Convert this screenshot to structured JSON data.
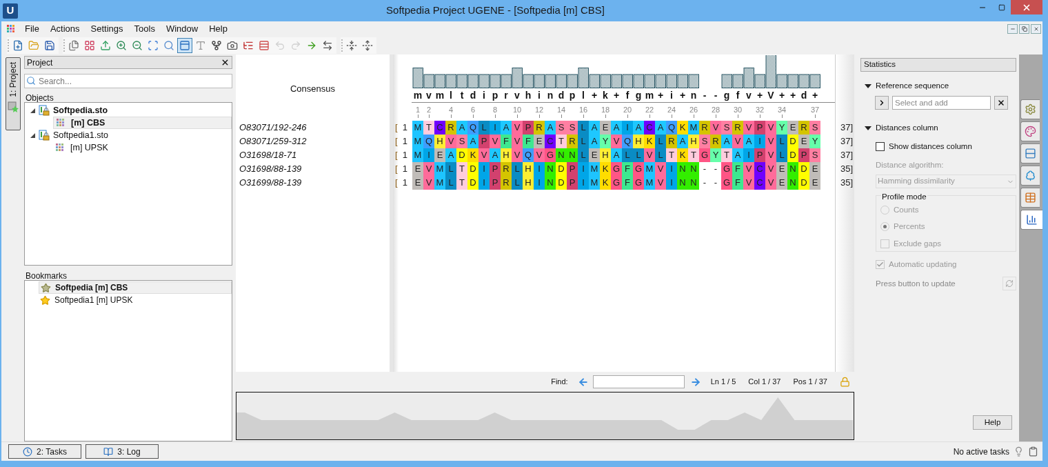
{
  "window": {
    "logo": "U",
    "title": "Softpedia Project UGENE - [Softpedia [m] CBS]"
  },
  "menu": [
    "File",
    "Actions",
    "Settings",
    "Tools",
    "Window",
    "Help"
  ],
  "toolbar": [
    [
      {
        "kind": "new",
        "selected": false,
        "disabled": false
      },
      {
        "kind": "open",
        "selected": false,
        "disabled": false
      },
      {
        "kind": "save",
        "selected": false,
        "disabled": false
      }
    ],
    [
      {
        "kind": "copy",
        "selected": false,
        "disabled": false
      },
      {
        "kind": "export",
        "selected": false,
        "disabled": false
      },
      {
        "kind": "import",
        "selected": false,
        "disabled": false
      },
      {
        "kind": "zoom-in",
        "selected": false,
        "disabled": false
      },
      {
        "kind": "zoom-out",
        "selected": false,
        "disabled": false
      },
      {
        "kind": "zoom-fit",
        "selected": false,
        "disabled": false
      },
      {
        "kind": "zoom-reset",
        "selected": false,
        "disabled": false
      },
      {
        "kind": "overview",
        "selected": true,
        "disabled": false
      },
      {
        "kind": "add-text",
        "selected": false,
        "disabled": false
      },
      {
        "kind": "tree",
        "selected": false,
        "disabled": false
      },
      {
        "kind": "camera",
        "selected": false,
        "disabled": false
      },
      {
        "kind": "list",
        "selected": false,
        "disabled": false
      },
      {
        "kind": "rows",
        "selected": false,
        "disabled": false
      },
      {
        "kind": "undo",
        "selected": false,
        "disabled": true
      },
      {
        "kind": "redo",
        "selected": false,
        "disabled": true
      },
      {
        "kind": "next",
        "selected": false,
        "disabled": false
      },
      {
        "kind": "swap",
        "selected": false,
        "disabled": false
      }
    ],
    [
      {
        "kind": "collapse",
        "selected": false,
        "disabled": false
      },
      {
        "kind": "expand",
        "selected": false,
        "disabled": false
      }
    ]
  ],
  "side_tabs": [
    {
      "label": "1: Project",
      "selected": true
    }
  ],
  "project": {
    "title": "Project",
    "search": {
      "placeholder": "Search..."
    },
    "objects_label": "Objects",
    "tree": [
      {
        "label": "Softpedia.sto",
        "active": true,
        "expanded": true,
        "children": [
          {
            "label": "[m] CBS",
            "active": true,
            "selected": true
          }
        ]
      },
      {
        "label": "Softpedia1.sto",
        "active": false,
        "expanded": true,
        "children": [
          {
            "label": "[m] UPSK",
            "active": false,
            "selected": false
          }
        ]
      }
    ],
    "bookmarks_label": "Bookmarks",
    "bookmarks": [
      {
        "label": "Softpedia [m] CBS",
        "active": true,
        "selected": true
      },
      {
        "label": "Softpedia1 [m] UPSK",
        "active": false,
        "selected": false
      }
    ]
  },
  "alignment": {
    "consensus_label": "Consensus",
    "consensus": [
      "m",
      "v",
      "m",
      "l",
      "t",
      "d",
      "i",
      "p",
      "r",
      "v",
      "h",
      "i",
      "n",
      "d",
      "p",
      "l",
      "+",
      "k",
      "+",
      "f",
      "g",
      "m",
      "+",
      "i",
      "+",
      "n",
      "-",
      "-",
      "g",
      "f",
      "v",
      "+",
      "V",
      "+",
      "+",
      "d",
      "+"
    ],
    "ruler": [
      "1",
      "2",
      "4",
      "6",
      "8",
      "10",
      "12",
      "14",
      "16",
      "18",
      "20",
      "22",
      "24",
      "26",
      "28",
      "30",
      "32",
      "34",
      "37"
    ],
    "rows": [
      {
        "name": "O83071/192-246",
        "bracket": "[",
        "start": "1",
        "end": "37]",
        "residues": [
          {
            "residue": "M",
            "color": "#1ec4ff"
          },
          {
            "residue": "T",
            "color": "#ffccdd"
          },
          {
            "residue": "C",
            "color": "#7000ff"
          },
          {
            "residue": "R",
            "color": "#d4c400"
          },
          {
            "residue": "A",
            "color": "#1ec8ff"
          },
          {
            "residue": "Q",
            "color": "#3d9eff"
          },
          {
            "residue": "L",
            "color": "#0a8cc4"
          },
          {
            "residue": "I",
            "color": "#00a6e8"
          },
          {
            "residue": "A",
            "color": "#1ec8ff"
          },
          {
            "residue": "V",
            "color": "#ff6b9a"
          },
          {
            "residue": "P",
            "color": "#d2416e"
          },
          {
            "residue": "R",
            "color": "#d4c400"
          },
          {
            "residue": "A",
            "color": "#1ec8ff"
          },
          {
            "residue": "S",
            "color": "#ff7fa2"
          },
          {
            "residue": "S",
            "color": "#ff7fa2"
          },
          {
            "residue": "L",
            "color": "#0a8cc4"
          },
          {
            "residue": "A",
            "color": "#1ec8ff"
          },
          {
            "residue": "E",
            "color": "#c0bcb8"
          },
          {
            "residue": "A",
            "color": "#1ec8ff"
          },
          {
            "residue": "I",
            "color": "#00a6e8"
          },
          {
            "residue": "A",
            "color": "#1ec8ff"
          },
          {
            "residue": "C",
            "color": "#7000ff"
          },
          {
            "residue": "A",
            "color": "#1ec8ff"
          },
          {
            "residue": "Q",
            "color": "#3d9eff"
          },
          {
            "residue": "K",
            "color": "#ffdd00"
          },
          {
            "residue": "M",
            "color": "#1ec4ff"
          },
          {
            "residue": "R",
            "color": "#d4c400"
          },
          {
            "residue": "V",
            "color": "#ff6b9a"
          },
          {
            "residue": "S",
            "color": "#ff7fa2"
          },
          {
            "residue": "R",
            "color": "#d4c400"
          },
          {
            "residue": "V",
            "color": "#ff6b9a"
          },
          {
            "residue": "P",
            "color": "#d2416e"
          },
          {
            "residue": "V",
            "color": "#ff6b9a"
          },
          {
            "residue": "Y",
            "color": "#66ffaa"
          },
          {
            "residue": "E",
            "color": "#c0bcb8"
          },
          {
            "residue": "R",
            "color": "#d4c400"
          },
          {
            "residue": "S",
            "color": "#ff7fa2"
          }
        ]
      },
      {
        "name": "O83071/259-312",
        "bracket": "[",
        "start": "1",
        "end": "37]",
        "residues": [
          {
            "residue": "M",
            "color": "#1ec4ff"
          },
          {
            "residue": "Q",
            "color": "#3d9eff"
          },
          {
            "residue": "H",
            "color": "#ffee33"
          },
          {
            "residue": "V",
            "color": "#ff6b9a"
          },
          {
            "residue": "S",
            "color": "#ff7fa2"
          },
          {
            "residue": "A",
            "color": "#1ec8ff"
          },
          {
            "residue": "P",
            "color": "#d2416e"
          },
          {
            "residue": "V",
            "color": "#ff6b9a"
          },
          {
            "residue": "F",
            "color": "#3ee890"
          },
          {
            "residue": "V",
            "color": "#ff6b9a"
          },
          {
            "residue": "F",
            "color": "#3ee890"
          },
          {
            "residue": "E",
            "color": "#c0bcb8"
          },
          {
            "residue": "C",
            "color": "#7000ff"
          },
          {
            "residue": "T",
            "color": "#ffccdd"
          },
          {
            "residue": "R",
            "color": "#d4c400"
          },
          {
            "residue": "L",
            "color": "#0a8cc4"
          },
          {
            "residue": "A",
            "color": "#1ec8ff"
          },
          {
            "residue": "Y",
            "color": "#66ffaa"
          },
          {
            "residue": "V",
            "color": "#ff6b9a"
          },
          {
            "residue": "Q",
            "color": "#3d9eff"
          },
          {
            "residue": "H",
            "color": "#ffee33"
          },
          {
            "residue": "K",
            "color": "#ffdd00"
          },
          {
            "residue": "L",
            "color": "#0a8cc4"
          },
          {
            "residue": "R",
            "color": "#d4c400"
          },
          {
            "residue": "A",
            "color": "#1ec8ff"
          },
          {
            "residue": "H",
            "color": "#ffee33"
          },
          {
            "residue": "S",
            "color": "#ff7fa2"
          },
          {
            "residue": "R",
            "color": "#d4c400"
          },
          {
            "residue": "A",
            "color": "#1ec8ff"
          },
          {
            "residue": "V",
            "color": "#ff6b9a"
          },
          {
            "residue": "A",
            "color": "#1ec8ff"
          },
          {
            "residue": "I",
            "color": "#00a6e8"
          },
          {
            "residue": "V",
            "color": "#ff6b9a"
          },
          {
            "residue": "L",
            "color": "#0a8cc4"
          },
          {
            "residue": "D",
            "color": "#ffff00"
          },
          {
            "residue": "E",
            "color": "#c0bcb8"
          },
          {
            "residue": "Y",
            "color": "#66ffaa"
          }
        ]
      },
      {
        "name": "O31698/18-71",
        "bracket": "[",
        "start": "1",
        "end": "37]",
        "residues": [
          {
            "residue": "M",
            "color": "#1ec4ff"
          },
          {
            "residue": "I",
            "color": "#00a6e8"
          },
          {
            "residue": "E",
            "color": "#c0bcb8"
          },
          {
            "residue": "A",
            "color": "#1ec8ff"
          },
          {
            "residue": "D",
            "color": "#ffff00"
          },
          {
            "residue": "K",
            "color": "#ffdd00"
          },
          {
            "residue": "V",
            "color": "#ff6b9a"
          },
          {
            "residue": "A",
            "color": "#1ec8ff"
          },
          {
            "residue": "H",
            "color": "#ffee33"
          },
          {
            "residue": "V",
            "color": "#ff6b9a"
          },
          {
            "residue": "Q",
            "color": "#3d9eff"
          },
          {
            "residue": "V",
            "color": "#ff6b9a"
          },
          {
            "residue": "G",
            "color": "#ff5585"
          },
          {
            "residue": "N",
            "color": "#33ee00"
          },
          {
            "residue": "N",
            "color": "#33ee00"
          },
          {
            "residue": "L",
            "color": "#0a8cc4"
          },
          {
            "residue": "E",
            "color": "#c0bcb8"
          },
          {
            "residue": "H",
            "color": "#ffee33"
          },
          {
            "residue": "A",
            "color": "#1ec8ff"
          },
          {
            "residue": "L",
            "color": "#0a8cc4"
          },
          {
            "residue": "L",
            "color": "#0a8cc4"
          },
          {
            "residue": "V",
            "color": "#ff6b9a"
          },
          {
            "residue": "L",
            "color": "#0a8cc4"
          },
          {
            "residue": "T",
            "color": "#ffccdd"
          },
          {
            "residue": "K",
            "color": "#ffdd00"
          },
          {
            "residue": "T",
            "color": "#ffccdd"
          },
          {
            "residue": "G",
            "color": "#ff5585"
          },
          {
            "residue": "Y",
            "color": "#66ffaa"
          },
          {
            "residue": "T",
            "color": "#ffccdd"
          },
          {
            "residue": "A",
            "color": "#1ec8ff"
          },
          {
            "residue": "I",
            "color": "#00a6e8"
          },
          {
            "residue": "P",
            "color": "#d2416e"
          },
          {
            "residue": "V",
            "color": "#ff6b9a"
          },
          {
            "residue": "L",
            "color": "#0a8cc4"
          },
          {
            "residue": "D",
            "color": "#ffff00"
          },
          {
            "residue": "P",
            "color": "#d2416e"
          },
          {
            "residue": "S",
            "color": "#ff7fa2"
          }
        ]
      },
      {
        "name": "O31698/88-139",
        "bracket": "[",
        "start": "1",
        "end": "35]",
        "residues": [
          {
            "residue": "E",
            "color": "#c0bcb8"
          },
          {
            "residue": "V",
            "color": "#ff6b9a"
          },
          {
            "residue": "M",
            "color": "#1ec4ff"
          },
          {
            "residue": "L",
            "color": "#0a8cc4"
          },
          {
            "residue": "T",
            "color": "#ffccdd"
          },
          {
            "residue": "D",
            "color": "#ffff00"
          },
          {
            "residue": "I",
            "color": "#00a6e8"
          },
          {
            "residue": "P",
            "color": "#d2416e"
          },
          {
            "residue": "R",
            "color": "#d4c400"
          },
          {
            "residue": "L",
            "color": "#0a8cc4"
          },
          {
            "residue": "H",
            "color": "#ffee33"
          },
          {
            "residue": "I",
            "color": "#00a6e8"
          },
          {
            "residue": "N",
            "color": "#33ee00"
          },
          {
            "residue": "D",
            "color": "#ffff00"
          },
          {
            "residue": "P",
            "color": "#d2416e"
          },
          {
            "residue": "I",
            "color": "#00a6e8"
          },
          {
            "residue": "M",
            "color": "#1ec4ff"
          },
          {
            "residue": "K",
            "color": "#ffdd00"
          },
          {
            "residue": "G",
            "color": "#ff5585"
          },
          {
            "residue": "F",
            "color": "#3ee890"
          },
          {
            "residue": "G",
            "color": "#ff5585"
          },
          {
            "residue": "M",
            "color": "#1ec4ff"
          },
          {
            "residue": "V",
            "color": "#ff6b9a"
          },
          {
            "residue": "I",
            "color": "#00a6e8"
          },
          {
            "residue": "N",
            "color": "#33ee00"
          },
          {
            "residue": "N",
            "color": "#33ee00"
          },
          {
            "residue": "-",
            "color": "#ffffff"
          },
          {
            "residue": "-",
            "color": "#ffffff"
          },
          {
            "residue": "G",
            "color": "#ff5585"
          },
          {
            "residue": "F",
            "color": "#3ee890"
          },
          {
            "residue": "V",
            "color": "#ff6b9a"
          },
          {
            "residue": "C",
            "color": "#7000ff"
          },
          {
            "residue": "V",
            "color": "#ff6b9a"
          },
          {
            "residue": "E",
            "color": "#c0bcb8"
          },
          {
            "residue": "N",
            "color": "#33ee00"
          },
          {
            "residue": "D",
            "color": "#ffff00"
          },
          {
            "residue": "E",
            "color": "#c0bcb8"
          }
        ]
      },
      {
        "name": "O31699/88-139",
        "bracket": "[",
        "start": "1",
        "end": "35]",
        "residues": [
          {
            "residue": "E",
            "color": "#c0bcb8"
          },
          {
            "residue": "V",
            "color": "#ff6b9a"
          },
          {
            "residue": "M",
            "color": "#1ec4ff"
          },
          {
            "residue": "L",
            "color": "#0a8cc4"
          },
          {
            "residue": "T",
            "color": "#ffccdd"
          },
          {
            "residue": "D",
            "color": "#ffff00"
          },
          {
            "residue": "I",
            "color": "#00a6e8"
          },
          {
            "residue": "P",
            "color": "#d2416e"
          },
          {
            "residue": "R",
            "color": "#d4c400"
          },
          {
            "residue": "L",
            "color": "#0a8cc4"
          },
          {
            "residue": "H",
            "color": "#ffee33"
          },
          {
            "residue": "I",
            "color": "#00a6e8"
          },
          {
            "residue": "N",
            "color": "#33ee00"
          },
          {
            "residue": "D",
            "color": "#ffff00"
          },
          {
            "residue": "P",
            "color": "#d2416e"
          },
          {
            "residue": "I",
            "color": "#00a6e8"
          },
          {
            "residue": "M",
            "color": "#1ec4ff"
          },
          {
            "residue": "K",
            "color": "#ffdd00"
          },
          {
            "residue": "G",
            "color": "#ff5585"
          },
          {
            "residue": "F",
            "color": "#3ee890"
          },
          {
            "residue": "G",
            "color": "#ff5585"
          },
          {
            "residue": "M",
            "color": "#1ec4ff"
          },
          {
            "residue": "V",
            "color": "#ff6b9a"
          },
          {
            "residue": "I",
            "color": "#00a6e8"
          },
          {
            "residue": "N",
            "color": "#33ee00"
          },
          {
            "residue": "N",
            "color": "#33ee00"
          },
          {
            "residue": "-",
            "color": "#ffffff"
          },
          {
            "residue": "-",
            "color": "#ffffff"
          },
          {
            "residue": "G",
            "color": "#ff5585"
          },
          {
            "residue": "F",
            "color": "#3ee890"
          },
          {
            "residue": "V",
            "color": "#ff6b9a"
          },
          {
            "residue": "C",
            "color": "#7000ff"
          },
          {
            "residue": "V",
            "color": "#ff6b9a"
          },
          {
            "residue": "E",
            "color": "#c0bcb8"
          },
          {
            "residue": "N",
            "color": "#33ee00"
          },
          {
            "residue": "D",
            "color": "#ffff00"
          },
          {
            "residue": "E",
            "color": "#c0bcb8"
          }
        ]
      }
    ]
  },
  "find_bar": {
    "label": "Find:",
    "line": "Ln 1 / 5",
    "column": "Col 1 / 37",
    "position": "Pos 1 / 37"
  },
  "statistics": {
    "title": "Statistics",
    "reference": {
      "title": "Reference sequence",
      "expanded": true,
      "placeholder": "Select and add"
    },
    "distances": {
      "title": "Distances column",
      "expanded": true,
      "show_column": {
        "label": "Show distances column",
        "checked": false
      },
      "algorithm_label": "Distance algorithm:",
      "algorithm": {
        "value": "Hamming dissimilarity",
        "disabled": true
      },
      "profile_mode": {
        "title": "Profile mode",
        "options": [
          {
            "label": "Counts",
            "selected": false,
            "disabled": true
          },
          {
            "label": "Percents",
            "selected": true,
            "disabled": true
          }
        ],
        "exclude_gaps": {
          "label": "Exclude gaps",
          "checked": false,
          "disabled": true
        }
      },
      "auto_update": {
        "label": "Automatic updating",
        "checked": true,
        "disabled": true
      },
      "press_label": "Press button to update"
    },
    "help_button": "Help"
  },
  "side_icon_tabs": [
    {
      "kind": "settings",
      "selected": false
    },
    {
      "kind": "colors",
      "selected": false
    },
    {
      "kind": "rows",
      "selected": false
    },
    {
      "kind": "tree",
      "selected": false
    },
    {
      "kind": "table",
      "selected": false
    },
    {
      "kind": "statistics",
      "selected": true
    }
  ],
  "status_bar": {
    "tasks_button": "2: Tasks",
    "log_button": "3: Log",
    "status": "No active tasks"
  }
}
